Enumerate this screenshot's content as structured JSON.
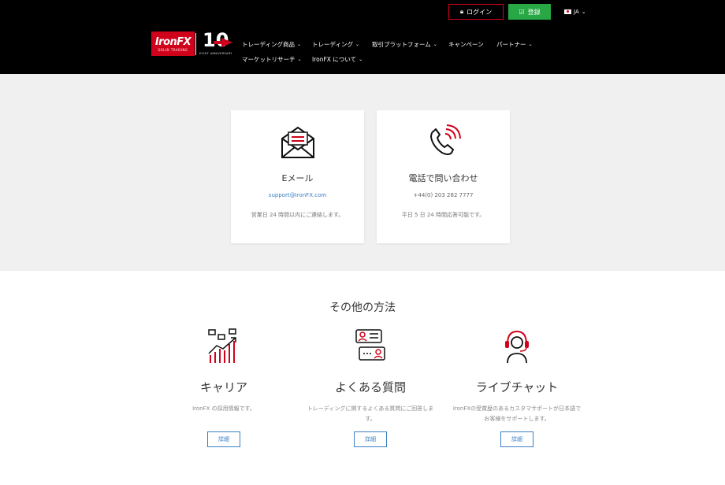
{
  "header": {
    "login_label": "ログイン",
    "register_label": "登録",
    "lang_label": "JA",
    "logo_text": "IronFX",
    "logo_sub": "SOLID TRADING",
    "anniv_number": "10",
    "anniv_sub": "EIGHT ANNIVERSARY",
    "nav_row1": [
      {
        "label": "トレーディング商品",
        "has_dropdown": true
      },
      {
        "label": "トレーディング",
        "has_dropdown": true
      },
      {
        "label": "取引プラットフォーム",
        "has_dropdown": true
      },
      {
        "label": "キャンペーン",
        "has_dropdown": false
      },
      {
        "label": "パートナー",
        "has_dropdown": true
      }
    ],
    "nav_row2": [
      {
        "label": "マーケットリサーチ",
        "has_dropdown": true
      },
      {
        "label": "IronFX について",
        "has_dropdown": true
      }
    ],
    "chevron": "⌄"
  },
  "contact": {
    "email": {
      "icon": "envelope-icon",
      "title": "Eメール",
      "link": "support@IronFX.com",
      "note": "営業日 24 時間以内にご連絡します。"
    },
    "phone": {
      "icon": "phone-icon",
      "title": "電話で問い合わせ",
      "value": "+44(0) 203 282 7777",
      "note": "平日 5 日 24 時間応答可能です。"
    }
  },
  "other": {
    "title": "その他の方法",
    "methods": [
      {
        "icon": "career-chart-icon",
        "title": "キャリア",
        "desc": "IronFX の採用情報です。",
        "button": "詳細"
      },
      {
        "icon": "faq-chat-icon",
        "title": "よくある質問",
        "desc": "トレーディングに関するよくある質問にご回答します。",
        "button": "詳細"
      },
      {
        "icon": "headset-support-icon",
        "title": "ライブチャット",
        "desc": "IronFXの受賞歴のあるカスタマサポートが日本語でお客様をサポートします。",
        "button": "詳細"
      }
    ]
  },
  "colors": {
    "brand_red": "#d0021b",
    "register_green": "#28a745",
    "link_blue": "#3b7fc4"
  }
}
